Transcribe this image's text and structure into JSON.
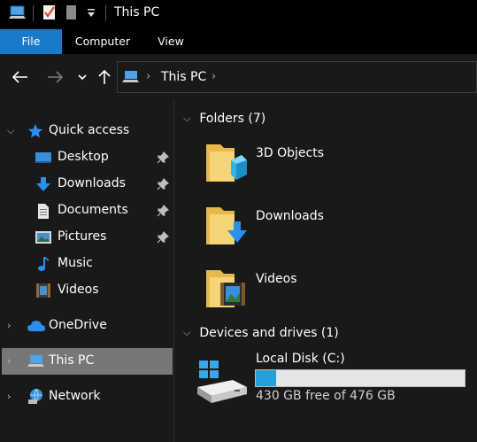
{
  "window": {
    "title": "This PC"
  },
  "quick_access_toolbar": {
    "icons": [
      "pc-icon",
      "properties-check-icon",
      "new-folder-icon",
      "customize-arrow-icon"
    ]
  },
  "ribbon": {
    "tabs": [
      {
        "label": "File",
        "active": true
      },
      {
        "label": "Computer",
        "active": false
      },
      {
        "label": "View",
        "active": false
      }
    ]
  },
  "address": {
    "path": "This PC"
  },
  "sidebar": {
    "items": [
      {
        "label": "Quick access",
        "icon": "star-icon",
        "expandable": true,
        "pinned": false
      },
      {
        "label": "Desktop",
        "icon": "desktop-icon",
        "pinned": true
      },
      {
        "label": "Downloads",
        "icon": "download-icon",
        "pinned": true
      },
      {
        "label": "Documents",
        "icon": "document-icon",
        "pinned": true
      },
      {
        "label": "Pictures",
        "icon": "pictures-icon",
        "pinned": true
      },
      {
        "label": "Music",
        "icon": "music-icon",
        "pinned": false
      },
      {
        "label": "Videos",
        "icon": "videos-icon",
        "pinned": false
      },
      {
        "label": "OneDrive",
        "icon": "cloud-icon",
        "expandable": true
      },
      {
        "label": "This PC",
        "icon": "pc-icon",
        "expandable": true,
        "selected": true
      },
      {
        "label": "Network",
        "icon": "network-icon",
        "expandable": true
      }
    ]
  },
  "main": {
    "folders_header": "Folders (7)",
    "folders": [
      {
        "label": "3D Objects",
        "icon": "3d-objects-folder-icon"
      },
      {
        "label": "Downloads",
        "icon": "downloads-folder-icon"
      },
      {
        "label": "Videos",
        "icon": "videos-folder-icon"
      }
    ],
    "drives_header": "Devices and drives (1)",
    "drives": [
      {
        "name": "Local Disk (C:)",
        "free_text": "430 GB free of 476 GB",
        "used_fraction": 0.097
      }
    ]
  },
  "colors": {
    "accent": "#1979ca",
    "drive_bar_fill": "#26a0da",
    "selected_item": "#777777",
    "background": "#191919"
  }
}
